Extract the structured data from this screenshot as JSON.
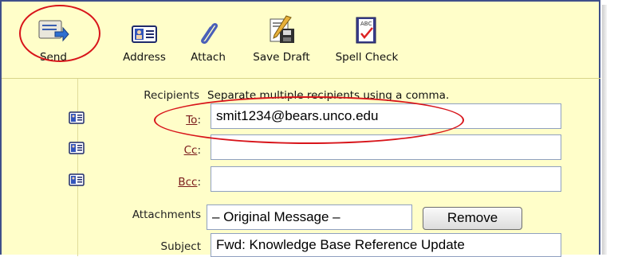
{
  "toolbar": {
    "send_label": "Send",
    "address_label": "Address",
    "attach_label": "Attach",
    "save_draft_label": "Save Draft",
    "spell_check_label": "Spell Check",
    "spell_check_icon_text": "ABC"
  },
  "form": {
    "recipients_label": "Recipients",
    "recipients_hint": "Separate multiple recipients using a comma.",
    "to_label": "To",
    "to_value": "smit1234@bears.unco.edu",
    "cc_label": "Cc",
    "cc_value": "",
    "bcc_label": "Bcc",
    "bcc_value": "",
    "attachments_label": "Attachments",
    "attachment_item": "– Original Message –",
    "remove_label": "Remove",
    "subject_label": "Subject",
    "subject_value": "Fwd: Knowledge Base Reference Update"
  },
  "colors": {
    "panel_bg": "#fffec9",
    "panel_border": "#3f4f8a",
    "annotation": "#d8141a",
    "link": "#7a1a1a"
  },
  "icons": [
    "send-icon",
    "address-book-icon",
    "paperclip-icon",
    "save-draft-icon",
    "spell-check-icon"
  ]
}
